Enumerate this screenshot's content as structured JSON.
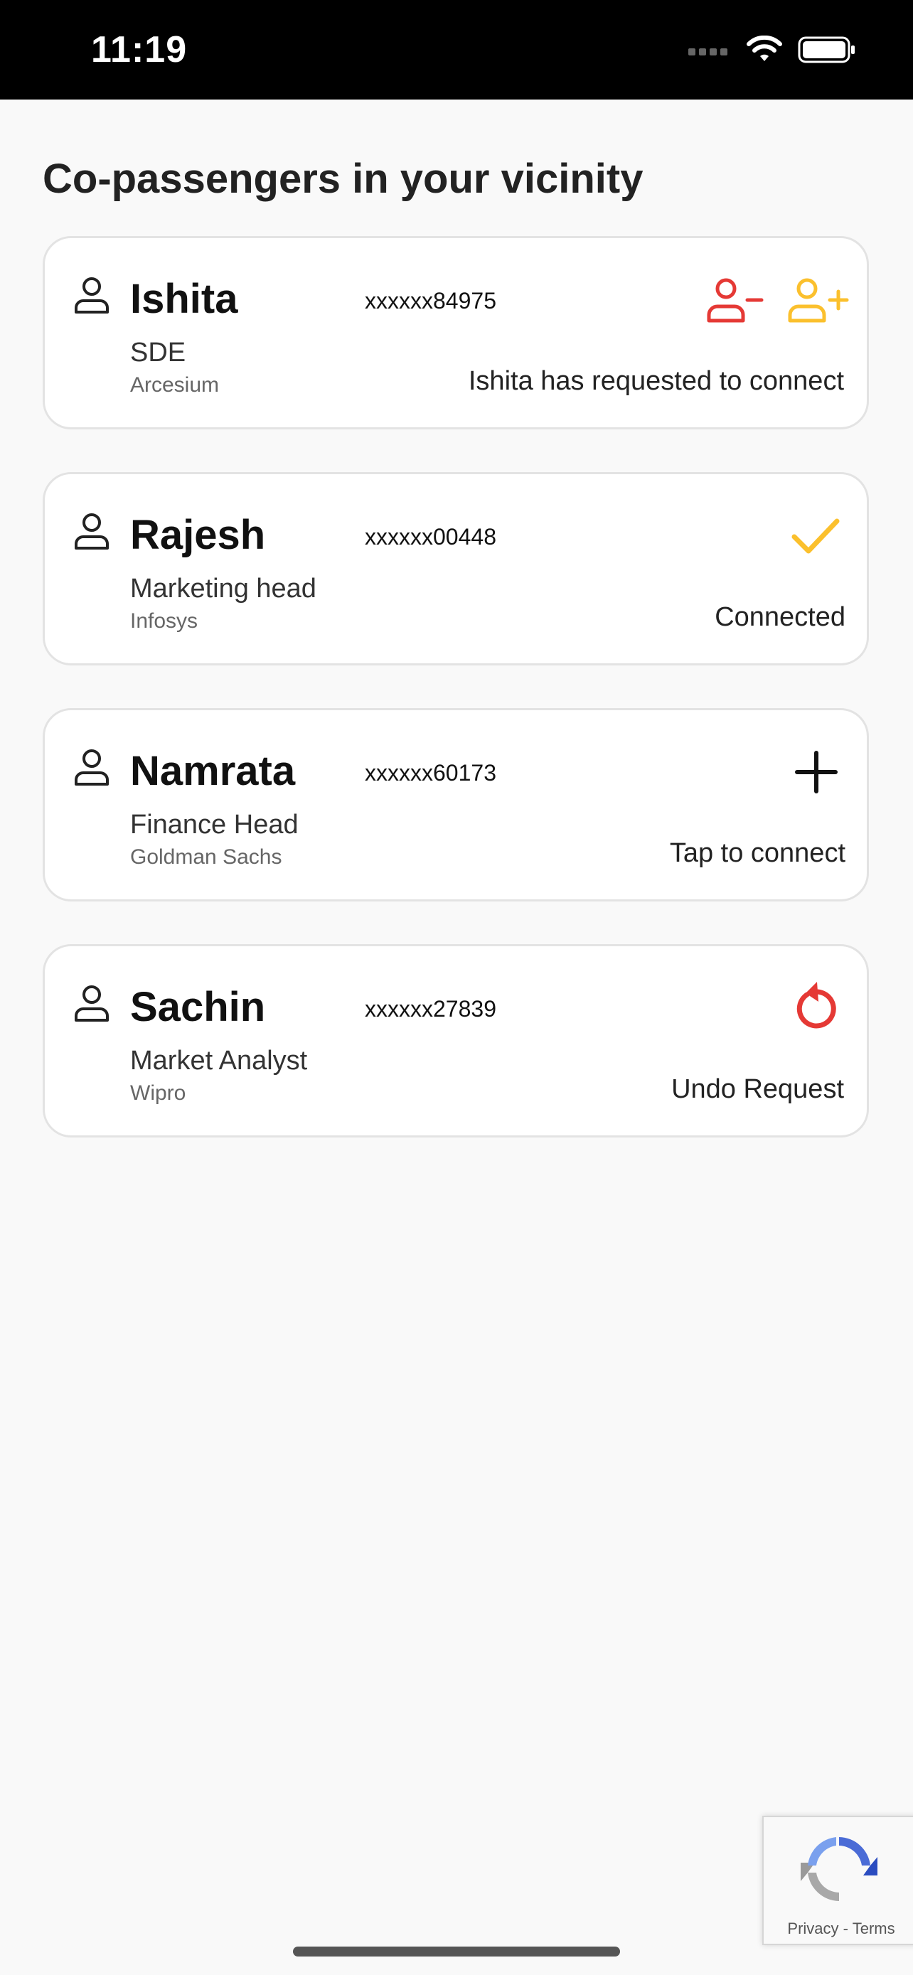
{
  "status_bar": {
    "time": "11:19"
  },
  "title": "Co-passengers in your vicinity",
  "passengers": [
    {
      "name": "Ishita",
      "phone": "xxxxxx84975",
      "role": "SDE",
      "company": "Arcesium",
      "status": "Ishita has requested to connect",
      "action": "request"
    },
    {
      "name": "Rajesh",
      "phone": "xxxxxx00448",
      "role": "Marketing head",
      "company": "Infosys",
      "status": "Connected",
      "action": "connected"
    },
    {
      "name": "Namrata",
      "phone": "xxxxxx60173",
      "role": "Finance Head",
      "company": "Goldman Sachs",
      "status": "Tap to connect",
      "action": "connect"
    },
    {
      "name": "Sachin",
      "phone": "xxxxxx27839",
      "role": "Market Analyst",
      "company": "Wipro",
      "status": "Undo Request",
      "action": "undo"
    }
  ],
  "recaptcha": {
    "privacy": "Privacy",
    "separator": "-",
    "terms": "Terms"
  },
  "colors": {
    "red": "#e53935",
    "yellow": "#fbc02d",
    "black": "#111111"
  },
  "icons": {
    "request": [
      "reject-user-icon",
      "accept-user-icon"
    ],
    "connected": [
      "checkmark-icon"
    ],
    "connect": [
      "plus-icon"
    ],
    "undo": [
      "undo-icon"
    ]
  }
}
